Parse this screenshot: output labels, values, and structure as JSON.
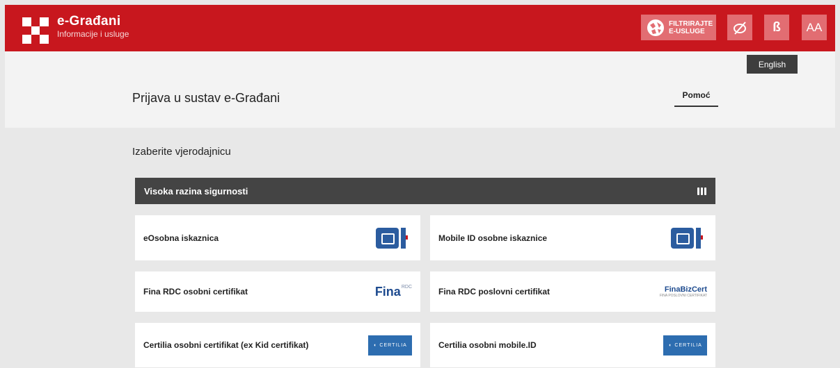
{
  "header": {
    "brand_title": "e-Građani",
    "brand_subtitle": "Informacije i usluge",
    "filter_line1": "FILTRIRAJTE",
    "filter_line2": "E-USLUGE",
    "font_size_label": "AA",
    "dyslexic_font_label": "ß",
    "language_tooltip": "English"
  },
  "page": {
    "title": "Prijava u sustav e-Građani",
    "help_label": "Pomoć",
    "section_title": "Izaberite vjerodajnicu",
    "level_label": "Visoka razina sigurnosti"
  },
  "credentials": [
    {
      "label": "eOsobna iskaznica",
      "logo": "eo-logo"
    },
    {
      "label": "Mobile ID osobne iskaznice",
      "logo": "eo-logo"
    },
    {
      "label": "Fina RDC osobni certifikat",
      "logo": "fina-rdc-logo",
      "logo_text": "Fina",
      "logo_small": "RDC"
    },
    {
      "label": "Fina RDC poslovni certifikat",
      "logo": "fina-bizcert-logo",
      "logo_text": "FinaBizCert",
      "logo_small": "FINA POSLOVNI CERTIFIKAT"
    },
    {
      "label": "Certilia osobni certifikat (ex Kid certifikat)",
      "logo": "certilia-logo",
      "logo_text": "CERTILIA"
    },
    {
      "label": "Certilia osobni mobile.ID",
      "logo": "certilia-logo",
      "logo_text": "CERTILIA"
    }
  ],
  "colors": {
    "brand_red": "#c8171e",
    "dark_bar": "#444444",
    "logo_blue": "#2b5c9f"
  }
}
